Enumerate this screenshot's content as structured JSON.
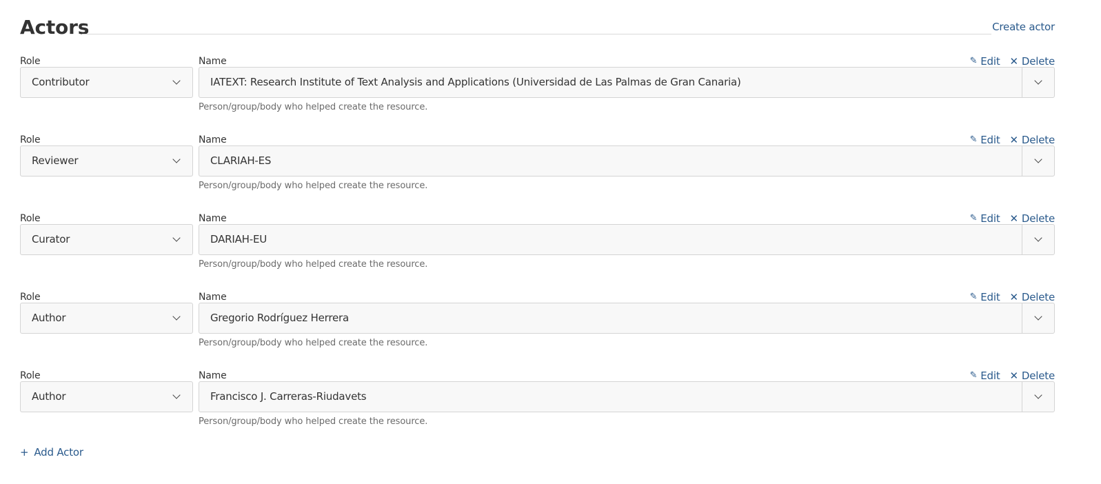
{
  "section": {
    "title": "Actors",
    "create_link": "Create actor"
  },
  "labels": {
    "role": "Role",
    "name": "Name",
    "edit": "Edit",
    "delete": "Delete",
    "help": "Person/group/body who helped create the resource."
  },
  "icons": {
    "edit": "pencil-icon",
    "delete": "close-icon",
    "dropdown": "chevron-down-icon",
    "add": "plus-icon"
  },
  "actors": [
    {
      "role": "Contributor",
      "name": "IATEXT: Research Institute of Text Analysis and Applications (Universidad de Las Palmas de Gran Canaria)"
    },
    {
      "role": "Reviewer",
      "name": "CLARIAH-ES"
    },
    {
      "role": "Curator",
      "name": "DARIAH-EU"
    },
    {
      "role": "Author",
      "name": "Gregorio Rodríguez Herrera"
    },
    {
      "role": "Author",
      "name": "Francisco J. Carreras-Riudavets"
    }
  ],
  "add_actor": {
    "label": "Add Actor"
  },
  "colors": {
    "link": "#2a5a8c",
    "text": "#333333",
    "muted": "#6b6b6b",
    "field_bg": "#f8f8f8",
    "border": "#d4d4d4"
  }
}
